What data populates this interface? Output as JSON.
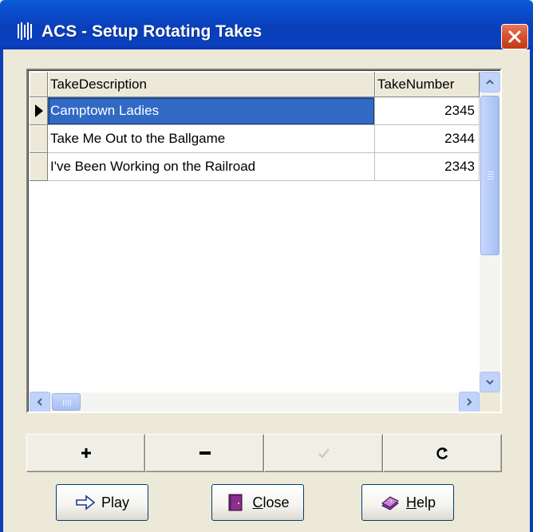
{
  "window": {
    "title": "ACS - Setup Rotating Takes",
    "icon": "acs-app-icon",
    "colors": {
      "titlebar": "#0a3fb8",
      "close_button": "#d8532f",
      "selection": "#316ac5",
      "background": "#ece9d8"
    }
  },
  "grid": {
    "columns": [
      {
        "label": "TakeDescription"
      },
      {
        "label": "TakeNumber"
      }
    ],
    "rows": [
      {
        "description": "Camptown Ladies",
        "number": "2345",
        "selected": true
      },
      {
        "description": "Take Me Out to the Ballgame",
        "number": "2344",
        "selected": false
      },
      {
        "description": "I've Been Working on the Railroad",
        "number": "2343",
        "selected": false
      }
    ]
  },
  "navigator": {
    "buttons": [
      {
        "icon": "plus-icon",
        "enabled": true
      },
      {
        "icon": "minus-icon",
        "enabled": true
      },
      {
        "icon": "checkmark-icon",
        "enabled": false
      },
      {
        "icon": "refresh-icon",
        "enabled": true
      }
    ]
  },
  "actions": {
    "play": {
      "label": "Play",
      "icon": "play-arrow-icon"
    },
    "close": {
      "label": "Close",
      "icon": "door-icon"
    },
    "help": {
      "label": "Help",
      "icon": "help-book-icon"
    }
  }
}
